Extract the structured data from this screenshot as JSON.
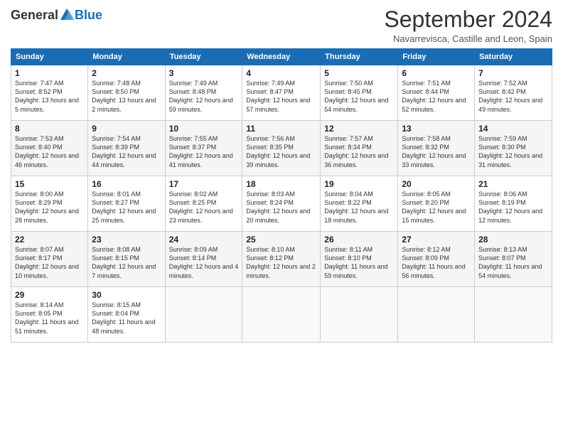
{
  "header": {
    "logo_general": "General",
    "logo_blue": "Blue",
    "month_title": "September 2024",
    "location": "Navarrevisca, Castille and Leon, Spain"
  },
  "weekdays": [
    "Sunday",
    "Monday",
    "Tuesday",
    "Wednesday",
    "Thursday",
    "Friday",
    "Saturday"
  ],
  "weeks": [
    [
      {
        "day": "1",
        "sunrise": "Sunrise: 7:47 AM",
        "sunset": "Sunset: 8:52 PM",
        "daylight": "Daylight: 13 hours and 5 minutes."
      },
      {
        "day": "2",
        "sunrise": "Sunrise: 7:48 AM",
        "sunset": "Sunset: 8:50 PM",
        "daylight": "Daylight: 13 hours and 2 minutes."
      },
      {
        "day": "3",
        "sunrise": "Sunrise: 7:49 AM",
        "sunset": "Sunset: 8:48 PM",
        "daylight": "Daylight: 12 hours and 59 minutes."
      },
      {
        "day": "4",
        "sunrise": "Sunrise: 7:49 AM",
        "sunset": "Sunset: 8:47 PM",
        "daylight": "Daylight: 12 hours and 57 minutes."
      },
      {
        "day": "5",
        "sunrise": "Sunrise: 7:50 AM",
        "sunset": "Sunset: 8:45 PM",
        "daylight": "Daylight: 12 hours and 54 minutes."
      },
      {
        "day": "6",
        "sunrise": "Sunrise: 7:51 AM",
        "sunset": "Sunset: 8:44 PM",
        "daylight": "Daylight: 12 hours and 52 minutes."
      },
      {
        "day": "7",
        "sunrise": "Sunrise: 7:52 AM",
        "sunset": "Sunset: 8:42 PM",
        "daylight": "Daylight: 12 hours and 49 minutes."
      }
    ],
    [
      {
        "day": "8",
        "sunrise": "Sunrise: 7:53 AM",
        "sunset": "Sunset: 8:40 PM",
        "daylight": "Daylight: 12 hours and 46 minutes."
      },
      {
        "day": "9",
        "sunrise": "Sunrise: 7:54 AM",
        "sunset": "Sunset: 8:39 PM",
        "daylight": "Daylight: 12 hours and 44 minutes."
      },
      {
        "day": "10",
        "sunrise": "Sunrise: 7:55 AM",
        "sunset": "Sunset: 8:37 PM",
        "daylight": "Daylight: 12 hours and 41 minutes."
      },
      {
        "day": "11",
        "sunrise": "Sunrise: 7:56 AM",
        "sunset": "Sunset: 8:35 PM",
        "daylight": "Daylight: 12 hours and 39 minutes."
      },
      {
        "day": "12",
        "sunrise": "Sunrise: 7:57 AM",
        "sunset": "Sunset: 8:34 PM",
        "daylight": "Daylight: 12 hours and 36 minutes."
      },
      {
        "day": "13",
        "sunrise": "Sunrise: 7:58 AM",
        "sunset": "Sunset: 8:32 PM",
        "daylight": "Daylight: 12 hours and 33 minutes."
      },
      {
        "day": "14",
        "sunrise": "Sunrise: 7:59 AM",
        "sunset": "Sunset: 8:30 PM",
        "daylight": "Daylight: 12 hours and 31 minutes."
      }
    ],
    [
      {
        "day": "15",
        "sunrise": "Sunrise: 8:00 AM",
        "sunset": "Sunset: 8:29 PM",
        "daylight": "Daylight: 12 hours and 28 minutes."
      },
      {
        "day": "16",
        "sunrise": "Sunrise: 8:01 AM",
        "sunset": "Sunset: 8:27 PM",
        "daylight": "Daylight: 12 hours and 25 minutes."
      },
      {
        "day": "17",
        "sunrise": "Sunrise: 8:02 AM",
        "sunset": "Sunset: 8:25 PM",
        "daylight": "Daylight: 12 hours and 23 minutes."
      },
      {
        "day": "18",
        "sunrise": "Sunrise: 8:03 AM",
        "sunset": "Sunset: 8:24 PM",
        "daylight": "Daylight: 12 hours and 20 minutes."
      },
      {
        "day": "19",
        "sunrise": "Sunrise: 8:04 AM",
        "sunset": "Sunset: 8:22 PM",
        "daylight": "Daylight: 12 hours and 18 minutes."
      },
      {
        "day": "20",
        "sunrise": "Sunrise: 8:05 AM",
        "sunset": "Sunset: 8:20 PM",
        "daylight": "Daylight: 12 hours and 15 minutes."
      },
      {
        "day": "21",
        "sunrise": "Sunrise: 8:06 AM",
        "sunset": "Sunset: 8:19 PM",
        "daylight": "Daylight: 12 hours and 12 minutes."
      }
    ],
    [
      {
        "day": "22",
        "sunrise": "Sunrise: 8:07 AM",
        "sunset": "Sunset: 8:17 PM",
        "daylight": "Daylight: 12 hours and 10 minutes."
      },
      {
        "day": "23",
        "sunrise": "Sunrise: 8:08 AM",
        "sunset": "Sunset: 8:15 PM",
        "daylight": "Daylight: 12 hours and 7 minutes."
      },
      {
        "day": "24",
        "sunrise": "Sunrise: 8:09 AM",
        "sunset": "Sunset: 8:14 PM",
        "daylight": "Daylight: 12 hours and 4 minutes."
      },
      {
        "day": "25",
        "sunrise": "Sunrise: 8:10 AM",
        "sunset": "Sunset: 8:12 PM",
        "daylight": "Daylight: 12 hours and 2 minutes."
      },
      {
        "day": "26",
        "sunrise": "Sunrise: 8:11 AM",
        "sunset": "Sunset: 8:10 PM",
        "daylight": "Daylight: 11 hours and 59 minutes."
      },
      {
        "day": "27",
        "sunrise": "Sunrise: 8:12 AM",
        "sunset": "Sunset: 8:09 PM",
        "daylight": "Daylight: 11 hours and 56 minutes."
      },
      {
        "day": "28",
        "sunrise": "Sunrise: 8:13 AM",
        "sunset": "Sunset: 8:07 PM",
        "daylight": "Daylight: 11 hours and 54 minutes."
      }
    ],
    [
      {
        "day": "29",
        "sunrise": "Sunrise: 8:14 AM",
        "sunset": "Sunset: 8:05 PM",
        "daylight": "Daylight: 11 hours and 51 minutes."
      },
      {
        "day": "30",
        "sunrise": "Sunrise: 8:15 AM",
        "sunset": "Sunset: 8:04 PM",
        "daylight": "Daylight: 11 hours and 48 minutes."
      },
      null,
      null,
      null,
      null,
      null
    ]
  ]
}
